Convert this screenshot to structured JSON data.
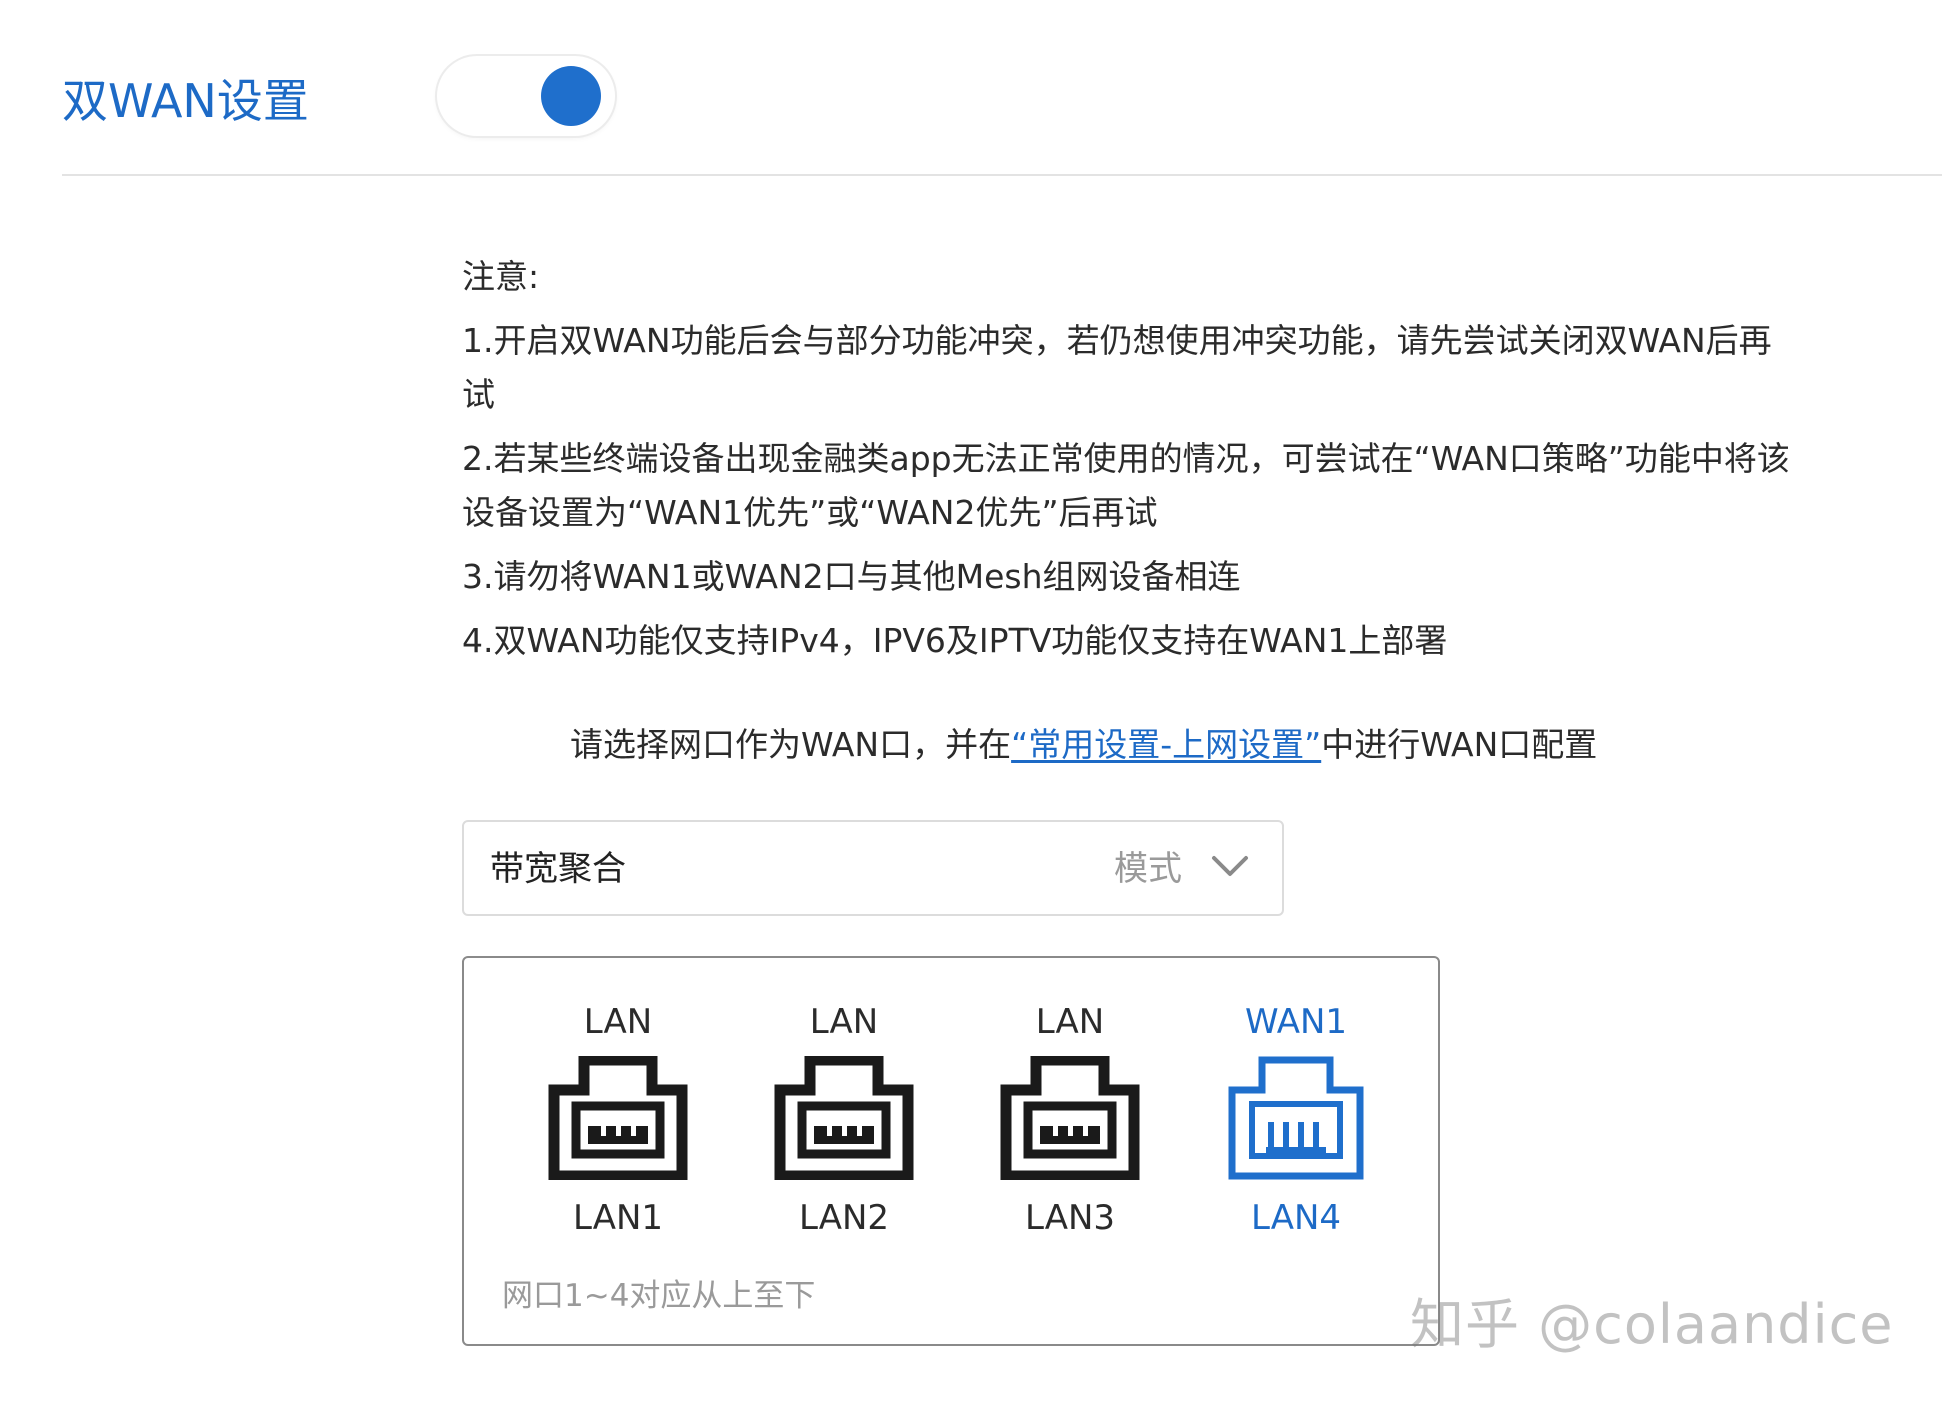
{
  "header": {
    "title": "双WAN设置",
    "toggle_on": true
  },
  "notice": {
    "title": "注意:",
    "items": [
      "1.开启双WAN功能后会与部分功能冲突，若仍想使用冲突功能，请先尝试关闭双WAN后再试",
      "2.若某些终端设备出现金融类app无法正常使用的情况，可尝试在“WAN口策略”功能中将该设备设置为“WAN1优先”或“WAN2优先”后再试",
      "3.请勿将WAN1或WAN2口与其他Mesh组网设备相连",
      "4.双WAN功能仅支持IPv4，IPV6及IPTV功能仅支持在WAN1上部署"
    ]
  },
  "instruction": {
    "before": "请选择网口作为WAN口，并在",
    "link": "“常用设置-上网设置”",
    "after": "中进行WAN口配置"
  },
  "mode_select": {
    "value": "带宽聚合",
    "label": "模式"
  },
  "ports": [
    {
      "role": "LAN",
      "name": "LAN1",
      "is_wan": false
    },
    {
      "role": "LAN",
      "name": "LAN2",
      "is_wan": false
    },
    {
      "role": "LAN",
      "name": "LAN3",
      "is_wan": false
    },
    {
      "role": "WAN1",
      "name": "LAN4",
      "is_wan": true
    }
  ],
  "ports_note": "网口1~4对应从上至下",
  "watermark": "知乎 @colaandice",
  "colors": {
    "accent": "#1f6fcc",
    "text": "#2b2b2b",
    "muted": "#9a9a9a",
    "port_normal": "#1a1a1a"
  }
}
